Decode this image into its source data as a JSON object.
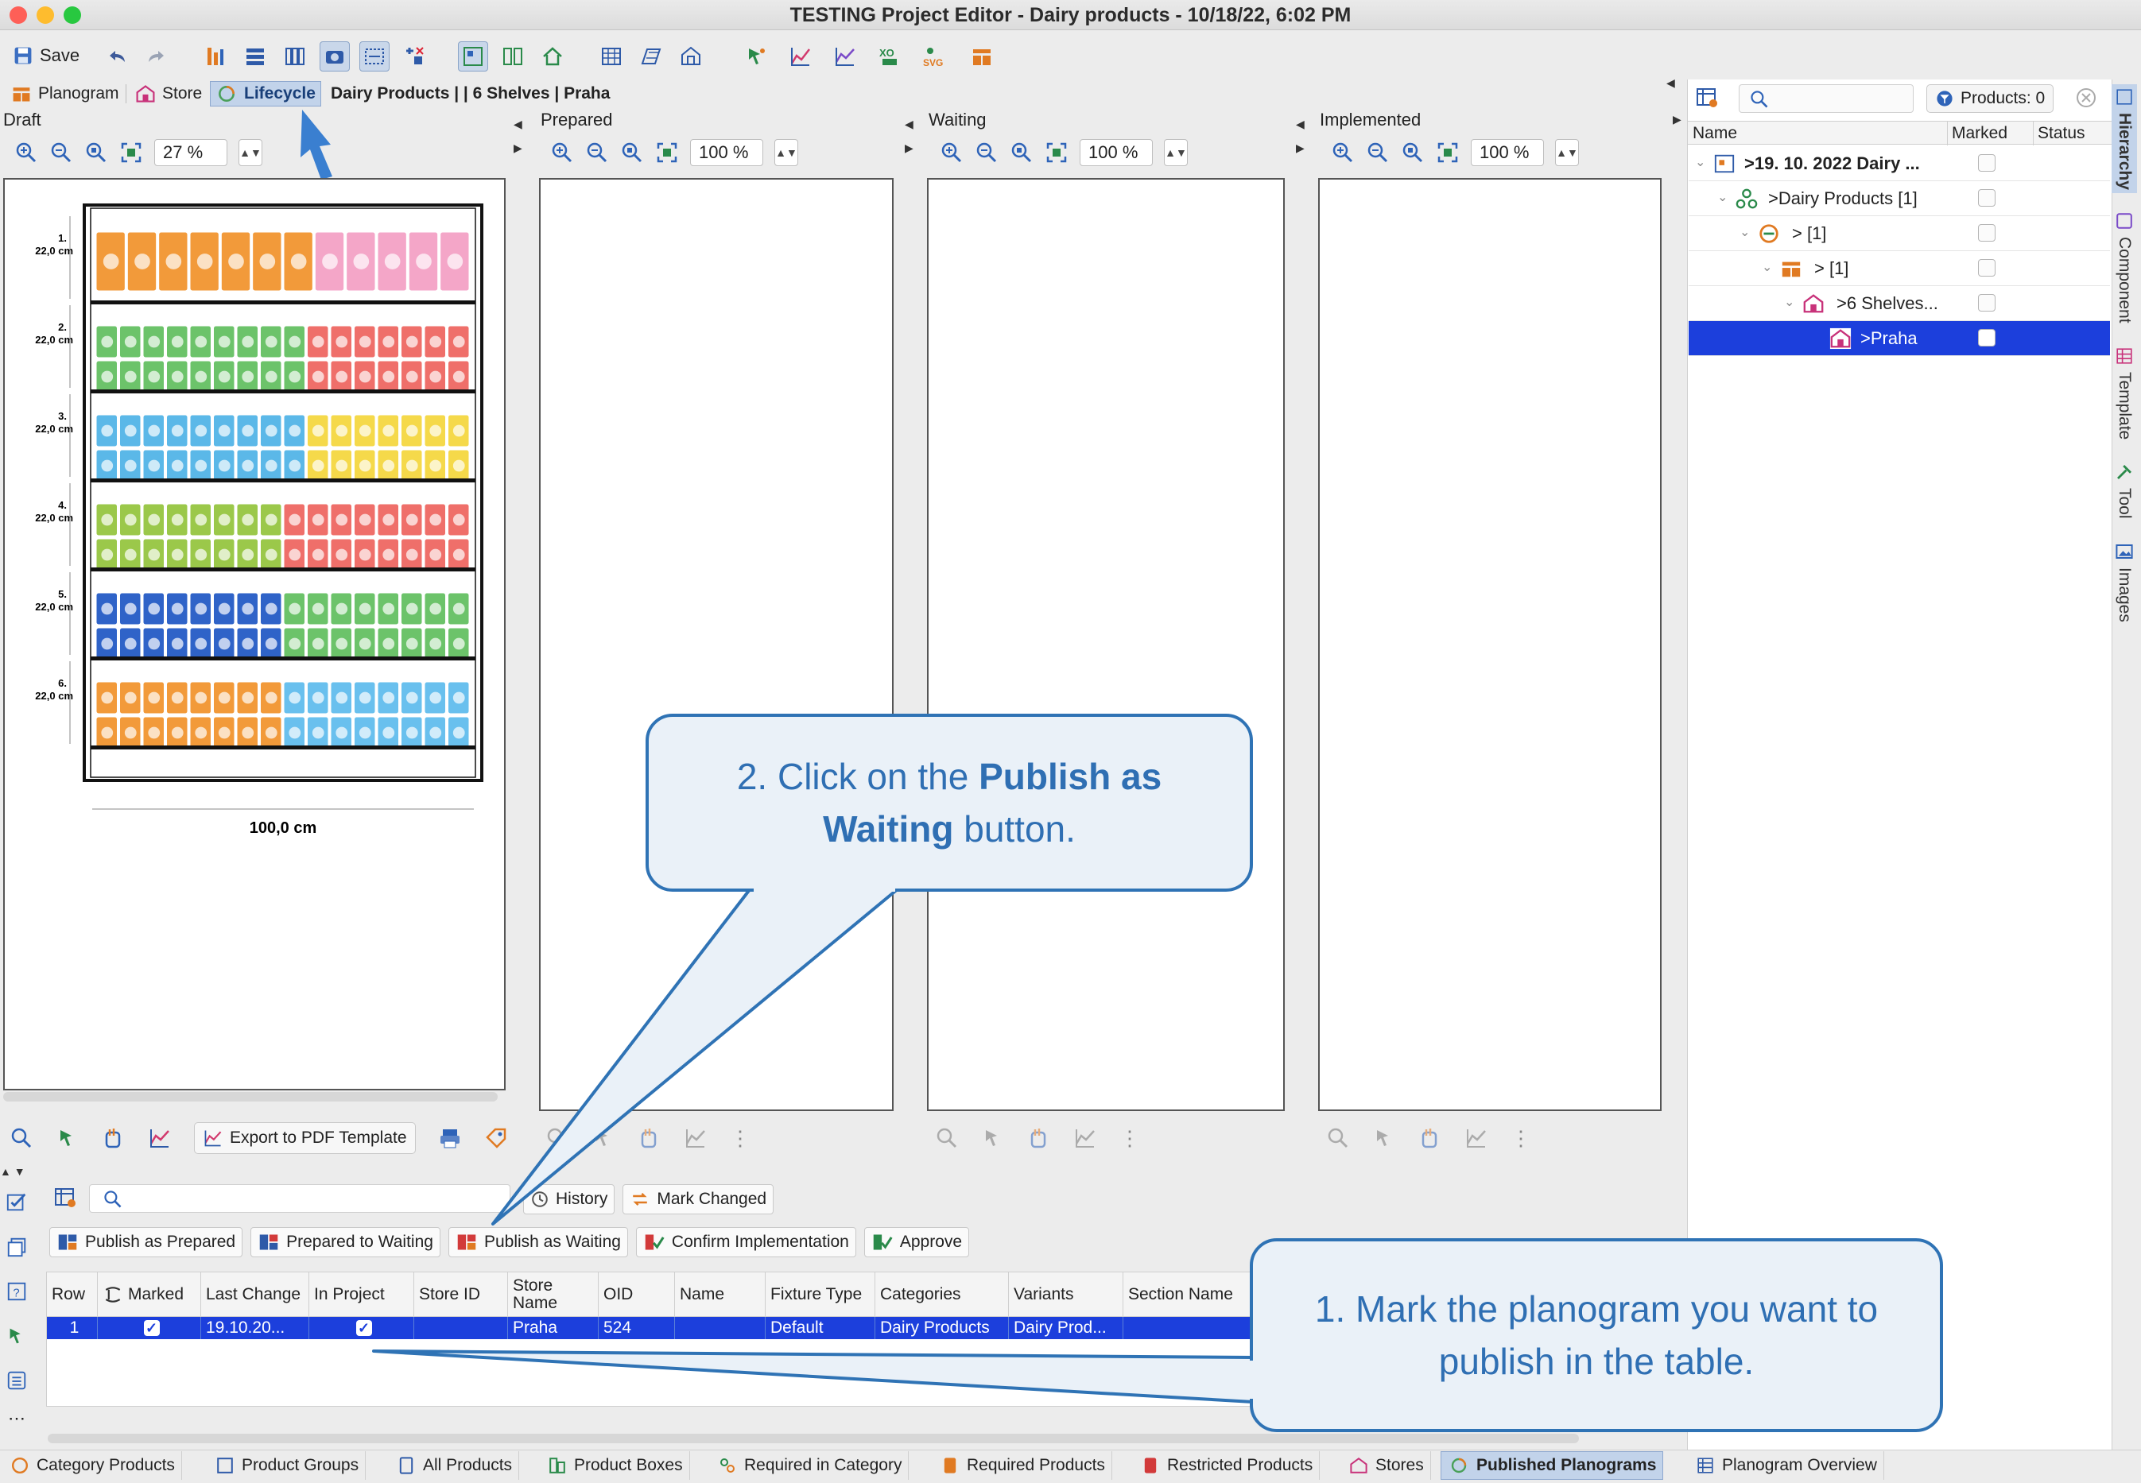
{
  "window": {
    "title": "TESTING Project Editor - Dairy products - 10/18/22, 6:02 PM"
  },
  "toolbar": {
    "save_label": "Save"
  },
  "tabs": {
    "planogram": "Planogram",
    "store": "Store",
    "lifecycle": "Lifecycle",
    "breadcrumb": "Dairy Products | | 6 Shelves | Praha"
  },
  "panels": {
    "draft": {
      "title": "Draft",
      "zoom": "27 %",
      "width_label": "100,0 cm",
      "export_label": "Export to PDF Template"
    },
    "prepared": {
      "title": "Prepared",
      "zoom": "100 %"
    },
    "waiting": {
      "title": "Waiting",
      "zoom": "100 %"
    },
    "implemented": {
      "title": "Implemented",
      "zoom": "100 %"
    }
  },
  "shelves": [
    {
      "num": "1.",
      "height": "22,0 cm"
    },
    {
      "num": "2.",
      "height": "22,0 cm"
    },
    {
      "num": "3.",
      "height": "22,0 cm"
    },
    {
      "num": "4.",
      "height": "22,0 cm"
    },
    {
      "num": "5.",
      "height": "22,0 cm"
    },
    {
      "num": "6.",
      "height": "22,0 cm"
    }
  ],
  "lifecycle": {
    "history": "History",
    "mark_changed": "Mark Changed",
    "publish_prepared": "Publish as Prepared",
    "prepared_to_waiting": "Prepared to Waiting",
    "publish_waiting": "Publish as Waiting",
    "confirm_impl": "Confirm Implementation",
    "approve": "Approve"
  },
  "table": {
    "headers": [
      "Row",
      "Marked",
      "Last Change",
      "In Project",
      "Store ID",
      "Store Name",
      "OID",
      "Name",
      "Fixture Type",
      "Categories",
      "Variants",
      "Section Name"
    ],
    "row": {
      "row": "1",
      "last_change": "19.10.20...",
      "store_id": "",
      "store_name": "Praha",
      "oid": "524",
      "name": "",
      "fixture": "Default",
      "categories": "Dairy Products",
      "variants": "Dairy Prod...",
      "section": ""
    }
  },
  "right": {
    "products_label": "Products: 0",
    "headers": {
      "name": "Name",
      "marked": "Marked",
      "status": "Status"
    },
    "tree": [
      ">19. 10. 2022 Dairy ...",
      ">Dairy Products [1]",
      "> [1]",
      "> [1]",
      ">6 Shelves...",
      ">Praha"
    ]
  },
  "side_tabs": [
    "Hierarchy",
    "Component",
    "Template",
    "Tool",
    "Images"
  ],
  "bottom_tabs": [
    "Category Products",
    "Product Groups",
    "All Products",
    "Product Boxes",
    "Required in Category",
    "Required Products",
    "Restricted Products",
    "Stores",
    "Published Planograms",
    "Planogram Overview"
  ],
  "callouts": {
    "step2_pre": "2. Click on the ",
    "step2_bold1": "Publish as",
    "step2_bold2": "Waiting",
    "step2_post": " button.",
    "step1_line1": "1. Mark the planogram you want to",
    "step1_line2": "publish in the table."
  },
  "colors": {
    "accent": "#2f73b5",
    "selection": "#1c3fdc",
    "callout_bg": "#eaf1f8"
  }
}
